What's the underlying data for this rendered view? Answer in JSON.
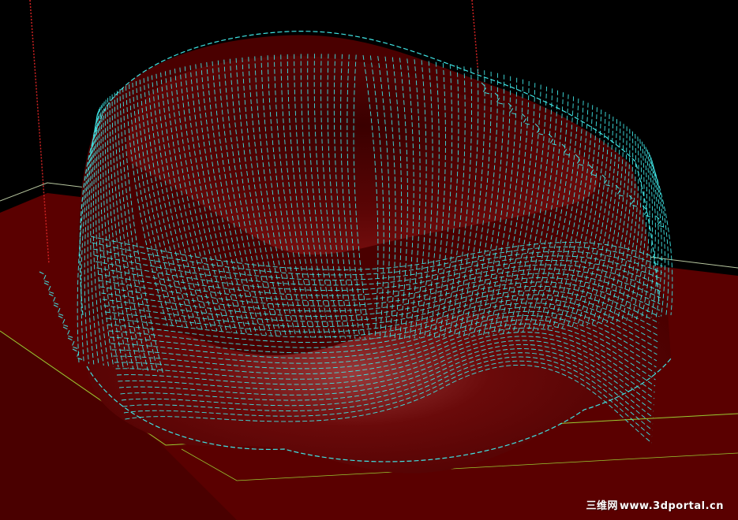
{
  "viewport": {
    "background_color": "#000000",
    "stock_color": "#5a0000",
    "stock_top_color": "#6e0505",
    "part_color": "#4a0000",
    "part_highlight_color": "#7a1010",
    "toolpath_color": "#3fe3e3",
    "rapid_move_color": "#cc2222",
    "boundary_color": "#b8c7a0",
    "axis_line_color": "#9acd32"
  },
  "watermark": {
    "cjk_text": "三维网",
    "url_text": "www.3dportal.cn"
  }
}
